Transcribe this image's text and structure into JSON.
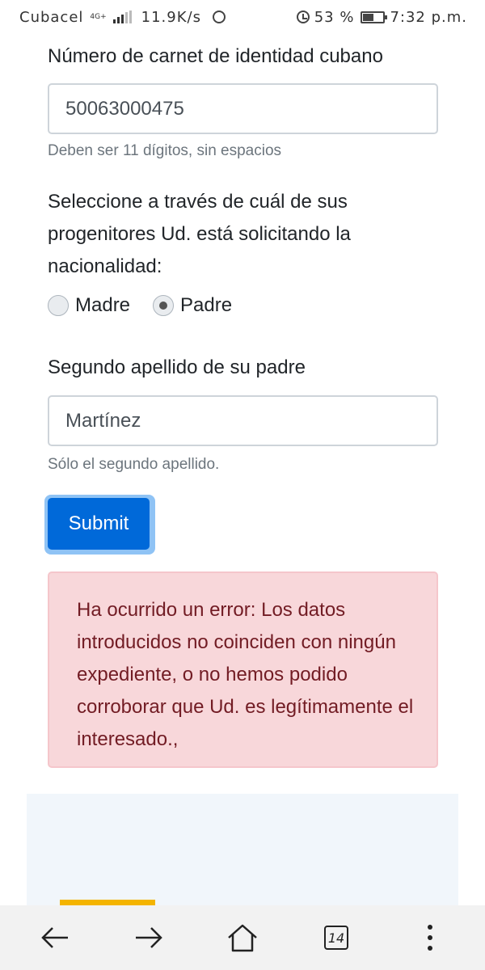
{
  "status_bar": {
    "carrier": "Cubacel",
    "network": "4G+",
    "speed": "11.9K/s",
    "battery_percent": "53 %",
    "time": "7:32 p.m.",
    "battery_level": 0.53
  },
  "form": {
    "ci_label": "Número de carnet de identidad cubano",
    "ci_value": "50063000475",
    "ci_help": "Deben ser 11 dígitos, sin espacios",
    "parent_label": "Seleccione a través de cuál de sus progenitores Ud. está solicitando la nacionalidad:",
    "option_mother": "Madre",
    "option_father": "Padre",
    "selected_option": "Padre",
    "surname_label": "Segundo apellido de su padre",
    "surname_value": "Martínez",
    "surname_help": "Sólo el segundo apellido.",
    "submit_label": "Submit"
  },
  "alert": {
    "message": "Ha ocurrido un error: Los datos introducidos no coinciden con ningún expediente, o no hemos podido corroborar que Ud. es legítimamente el interesado.,"
  },
  "bottom_nav": {
    "tab_count": "14",
    "icons": [
      "back-arrow-icon",
      "forward-arrow-icon",
      "home-icon",
      "tabs-icon",
      "more-vertical-icon"
    ]
  },
  "colors": {
    "primary": "#0069d9",
    "alert_bg": "#f8d7da",
    "alert_text": "#721c24",
    "accent": "#f4b400"
  }
}
